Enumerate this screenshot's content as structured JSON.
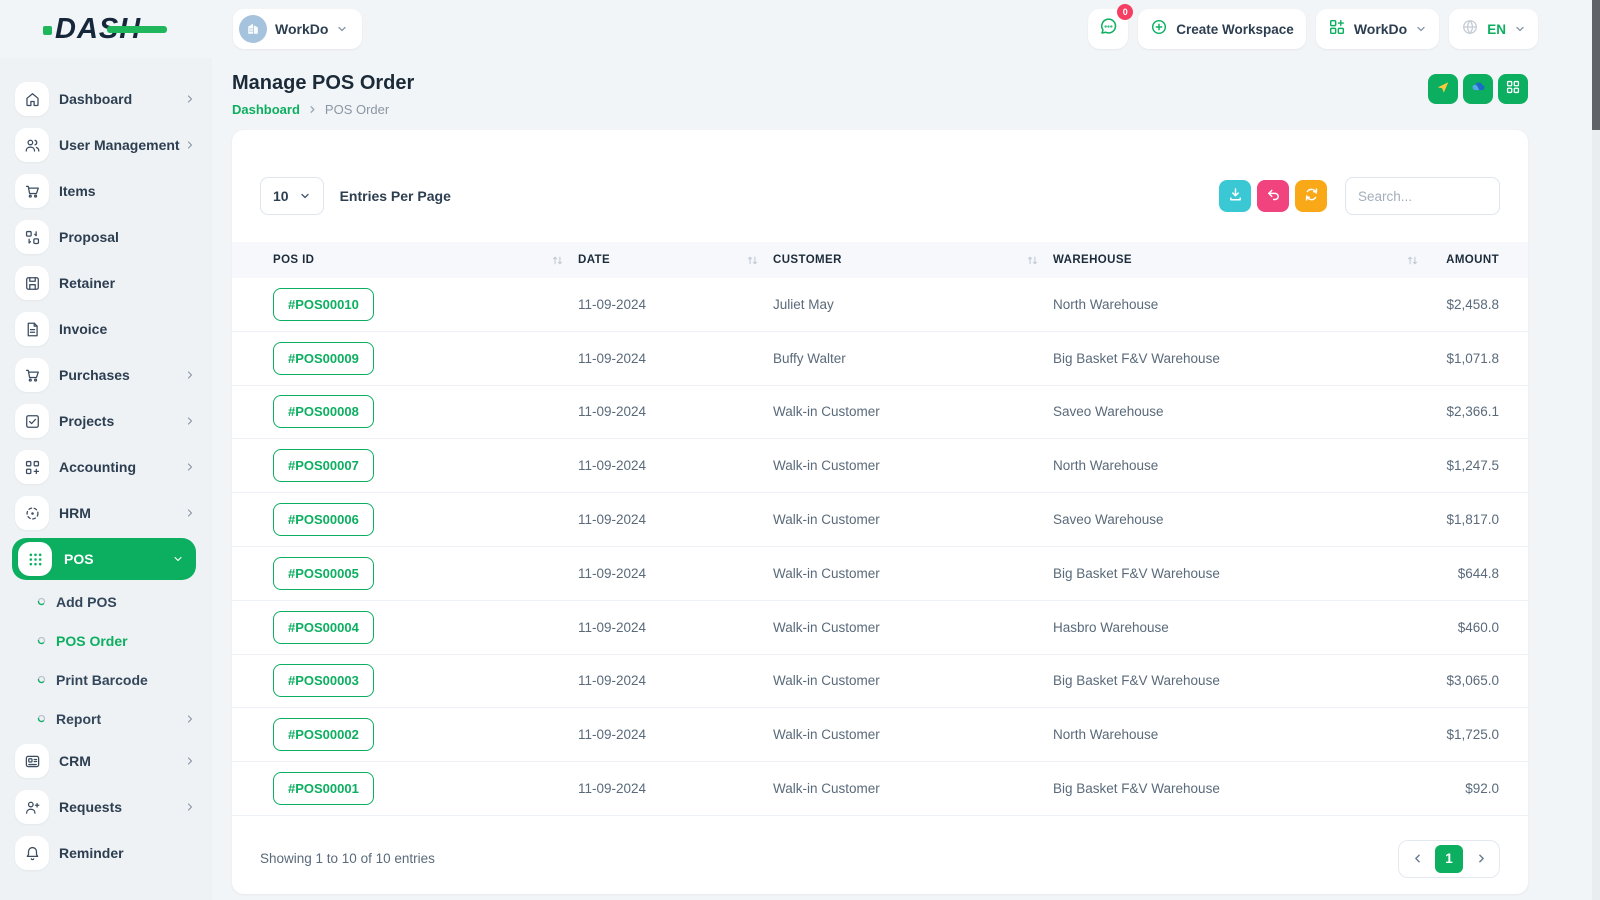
{
  "colors": {
    "primary": "#0CAF60",
    "teal": "#3BC8D5",
    "pink": "#F1437E",
    "orange": "#F9A817",
    "badge_red": "#F43F63"
  },
  "topbar": {
    "logo_text": "DASH",
    "workspace": {
      "label": "WorkDo",
      "avatar_icon": "building-icon"
    },
    "chat_badge": "0",
    "create_workspace": "Create Workspace",
    "app_menu": "WorkDo",
    "language": "EN"
  },
  "sidebar": {
    "items": [
      {
        "label": "Dashboard",
        "icon": "home-icon",
        "chevron": "right"
      },
      {
        "label": "User Management",
        "icon": "users-icon",
        "chevron": "right"
      },
      {
        "label": "Items",
        "icon": "cart-icon"
      },
      {
        "label": "Proposal",
        "icon": "proposal-icon"
      },
      {
        "label": "Retainer",
        "icon": "retainer-icon"
      },
      {
        "label": "Invoice",
        "icon": "invoice-icon"
      },
      {
        "label": "Purchases",
        "icon": "cart-icon",
        "chevron": "right"
      },
      {
        "label": "Projects",
        "icon": "check-square-icon",
        "chevron": "right"
      },
      {
        "label": "Accounting",
        "icon": "grid-plus-icon",
        "chevron": "right"
      },
      {
        "label": "HRM",
        "icon": "hrm-icon",
        "chevron": "right"
      },
      {
        "label": "POS",
        "icon": "pos-grid-icon",
        "chevron": "down",
        "active": true
      },
      {
        "label": "Add POS",
        "sub": true
      },
      {
        "label": "POS Order",
        "sub": true,
        "active": true
      },
      {
        "label": "Print Barcode",
        "sub": true
      },
      {
        "label": "Report",
        "sub": true,
        "chevron": "right"
      },
      {
        "label": "CRM",
        "icon": "crm-icon",
        "chevron": "right"
      },
      {
        "label": "Requests",
        "icon": "user-plus-icon",
        "chevron": "right"
      },
      {
        "label": "Reminder",
        "icon": "bell-icon"
      }
    ]
  },
  "page": {
    "title": "Manage POS Order",
    "breadcrumb": {
      "home": "Dashboard",
      "current": "POS Order"
    },
    "integrations": [
      {
        "icon": "drive-icon"
      },
      {
        "icon": "cloud-icon"
      },
      {
        "icon": "apps-grid-icon"
      }
    ]
  },
  "table": {
    "entries_per_page": "10",
    "entries_label": "Entries Per Page",
    "search_placeholder": "Search...",
    "export_buttons": [
      {
        "icon": "download-icon",
        "color": "#3BC8D5"
      },
      {
        "icon": "undo-icon",
        "color": "#F1437E"
      },
      {
        "icon": "refresh-icon",
        "color": "#F9A817"
      }
    ],
    "columns": [
      "POS ID",
      "DATE",
      "CUSTOMER",
      "WAREHOUSE",
      "AMOUNT"
    ],
    "rows": [
      {
        "pos_id": "#POS00010",
        "date": "11-09-2024",
        "customer": "Juliet May",
        "warehouse": "North Warehouse",
        "amount": "$2,458.8"
      },
      {
        "pos_id": "#POS00009",
        "date": "11-09-2024",
        "customer": "Buffy Walter",
        "warehouse": "Big Basket F&V Warehouse",
        "amount": "$1,071.8"
      },
      {
        "pos_id": "#POS00008",
        "date": "11-09-2024",
        "customer": "Walk-in Customer",
        "warehouse": "Saveo Warehouse",
        "amount": "$2,366.1"
      },
      {
        "pos_id": "#POS00007",
        "date": "11-09-2024",
        "customer": "Walk-in Customer",
        "warehouse": "North Warehouse",
        "amount": "$1,247.5"
      },
      {
        "pos_id": "#POS00006",
        "date": "11-09-2024",
        "customer": "Walk-in Customer",
        "warehouse": "Saveo Warehouse",
        "amount": "$1,817.0"
      },
      {
        "pos_id": "#POS00005",
        "date": "11-09-2024",
        "customer": "Walk-in Customer",
        "warehouse": "Big Basket F&V Warehouse",
        "amount": "$644.8"
      },
      {
        "pos_id": "#POS00004",
        "date": "11-09-2024",
        "customer": "Walk-in Customer",
        "warehouse": "Hasbro Warehouse",
        "amount": "$460.0"
      },
      {
        "pos_id": "#POS00003",
        "date": "11-09-2024",
        "customer": "Walk-in Customer",
        "warehouse": "Big Basket F&V Warehouse",
        "amount": "$3,065.0"
      },
      {
        "pos_id": "#POS00002",
        "date": "11-09-2024",
        "customer": "Walk-in Customer",
        "warehouse": "North Warehouse",
        "amount": "$1,725.0"
      },
      {
        "pos_id": "#POS00001",
        "date": "11-09-2024",
        "customer": "Walk-in Customer",
        "warehouse": "Big Basket F&V Warehouse",
        "amount": "$92.0"
      }
    ],
    "footer_text": "Showing 1 to 10 of 10 entries",
    "pagination": {
      "current": "1"
    }
  }
}
